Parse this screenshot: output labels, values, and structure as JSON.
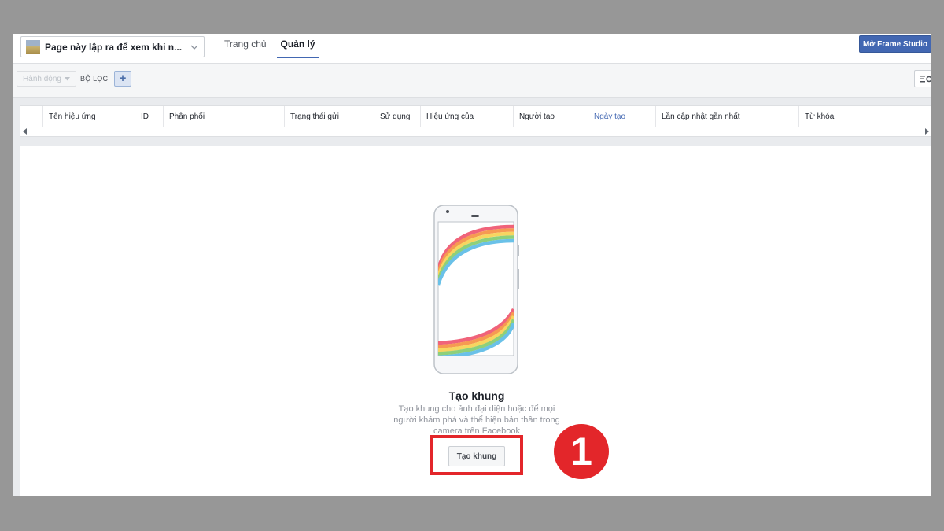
{
  "topbar": {
    "page_name": "Page này lập ra để xem khi n...",
    "tabs": [
      {
        "label": "Trang chủ",
        "active": false
      },
      {
        "label": "Quản lý",
        "active": true
      }
    ],
    "studio_button": "Mở Frame Studio"
  },
  "toolbar": {
    "actions_label": "Hành động",
    "filter_label": "BỘ LỌC:",
    "add_filter": "+"
  },
  "table": {
    "columns": [
      {
        "label": "Tên hiệu ứng"
      },
      {
        "label": "ID"
      },
      {
        "label": "Phân phối"
      },
      {
        "label": "Trạng thái gửi"
      },
      {
        "label": "Sử dụng"
      },
      {
        "label": "Hiệu ứng của"
      },
      {
        "label": "Người tạo"
      },
      {
        "label": "Ngày tạo",
        "sorted": true
      },
      {
        "label": "Lần cập nhật gần nhất"
      },
      {
        "label": "Từ khóa"
      }
    ]
  },
  "empty_state": {
    "title": "Tạo khung",
    "description": "Tạo khung cho ảnh đại diện hoặc để mọi người khám phá và thể hiện bản thân trong camera trên Facebook",
    "create_button": "Tạo khung"
  },
  "annotation": {
    "step_number": "1",
    "color": "#e3262a"
  },
  "colors": {
    "brand_blue": "#4267b2",
    "background": "#e9ebee"
  }
}
